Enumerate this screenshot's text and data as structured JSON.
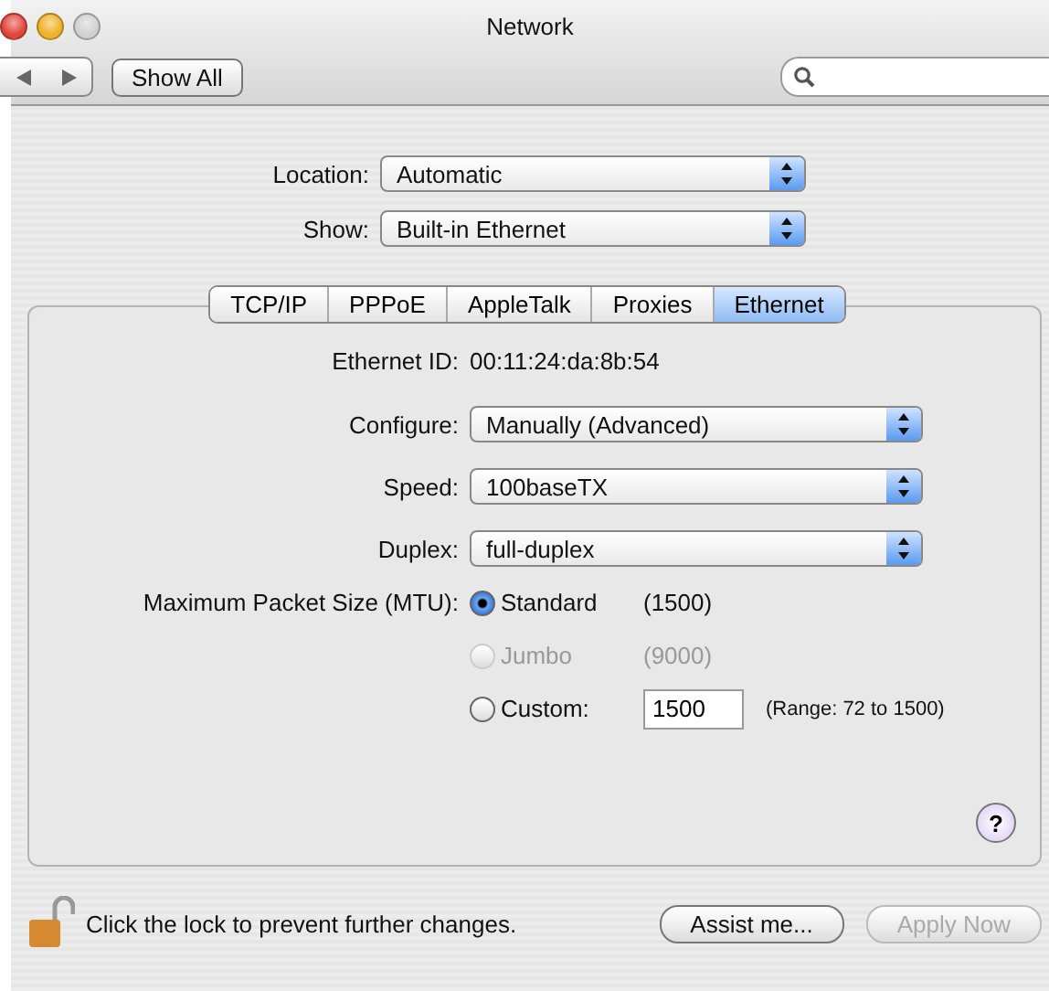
{
  "window": {
    "title": "Network"
  },
  "toolbar": {
    "show_all": "Show All"
  },
  "location": {
    "label": "Location:",
    "value": "Automatic"
  },
  "show": {
    "label": "Show:",
    "value": "Built-in Ethernet"
  },
  "tabs": [
    {
      "label": "TCP/IP",
      "selected": false
    },
    {
      "label": "PPPoE",
      "selected": false
    },
    {
      "label": "AppleTalk",
      "selected": false
    },
    {
      "label": "Proxies",
      "selected": false
    },
    {
      "label": "Ethernet",
      "selected": true
    }
  ],
  "ethernet_id": {
    "label": "Ethernet ID:",
    "value": "00:11:24:da:8b:54"
  },
  "popups": [
    {
      "label": "Configure:",
      "value": "Manually (Advanced)"
    },
    {
      "label": "Speed:",
      "value": "100baseTX"
    },
    {
      "label": "Duplex:",
      "value": "full-duplex"
    }
  ],
  "mtu": {
    "label": "Maximum Packet Size (MTU):",
    "options": [
      {
        "kind": "plain",
        "label": "Standard",
        "value": "(1500)",
        "selected": true,
        "disabled": false
      },
      {
        "kind": "plain",
        "label": "Jumbo",
        "value": "(9000)",
        "selected": false,
        "disabled": true
      },
      {
        "kind": "custom",
        "label": "Custom:",
        "value": "1500",
        "selected": false,
        "disabled": false,
        "range": "(Range: 72 to 1500)"
      }
    ]
  },
  "help": "?",
  "lock_text": "Click the lock to prevent further changes.",
  "buttons": [
    {
      "label": "Assist me...",
      "disabled": false
    },
    {
      "label": "Apply Now",
      "disabled": true
    }
  ]
}
